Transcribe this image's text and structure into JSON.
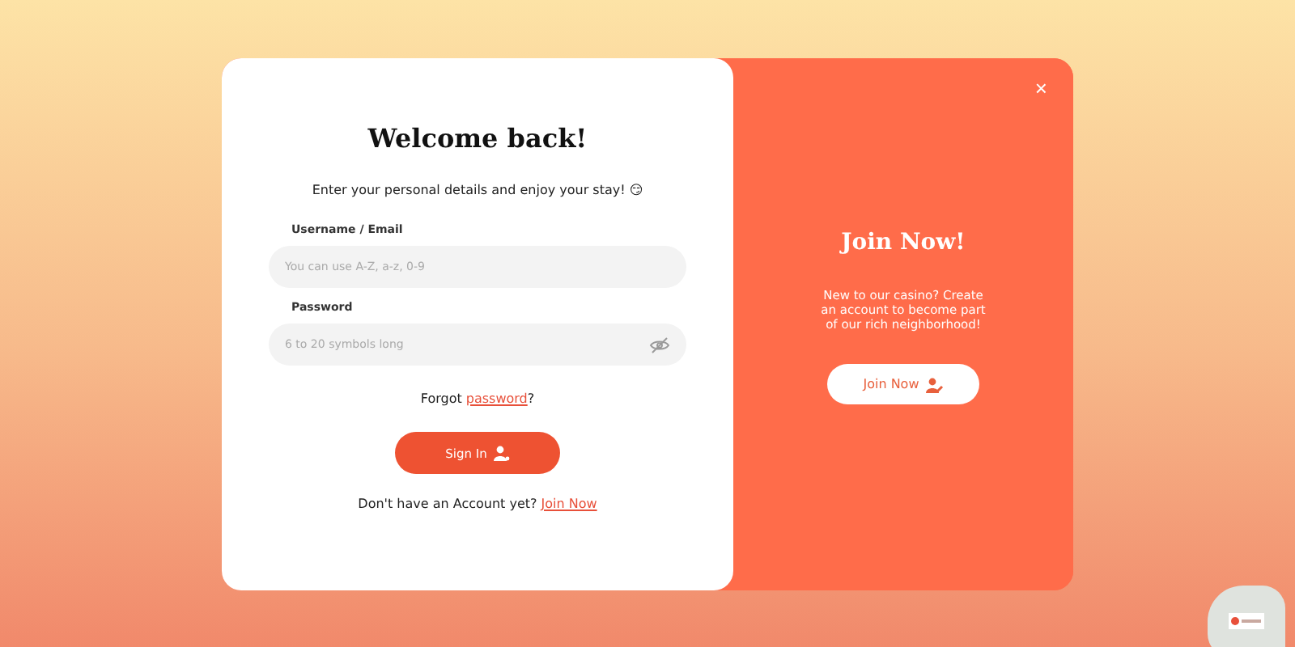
{
  "login": {
    "title": "Welcome back!",
    "subtitle": "Enter your personal details and enjoy your stay! 😏",
    "fields": [
      {
        "label": "Username / Email",
        "placeholder": "You can use A-Z, a-z, 0-9",
        "kind": "text"
      },
      {
        "label": "Password",
        "placeholder": "6 to 20 symbols long",
        "kind": "password"
      }
    ],
    "forgot": {
      "before": "Forgot ",
      "link": "password",
      "after": "?"
    },
    "button": "Sign In",
    "signup": {
      "before": "Don't have an Account yet? ",
      "link": "Join Now"
    }
  },
  "promo": {
    "close": "×",
    "title": "Join Now!",
    "text": "New to our casino? Create an account to become part of our rich neighborhood!",
    "button": "Join Now"
  }
}
